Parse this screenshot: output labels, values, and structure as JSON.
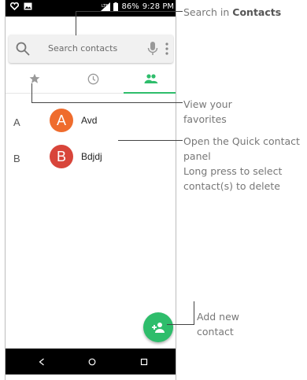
{
  "status_bar": {
    "signal_label": "LTE",
    "battery": "86%",
    "time": "9:28 PM"
  },
  "search": {
    "placeholder": "Search contacts"
  },
  "tabs": [
    {
      "name": "favorites",
      "icon": "star-icon"
    },
    {
      "name": "recents",
      "icon": "clock-icon"
    },
    {
      "name": "contacts",
      "icon": "people-icon",
      "selected": true
    }
  ],
  "contacts": [
    {
      "section": "A",
      "initial": "A",
      "name": "Avd",
      "color": "#ef6c2d"
    },
    {
      "section": "B",
      "initial": "B",
      "name": "Bdjdj",
      "color": "#d8453a"
    }
  ],
  "fab": {
    "icon": "add-person-icon",
    "color": "#2ebd6b"
  },
  "annotations": {
    "search_prefix": "Search in ",
    "search_bold": "Contacts",
    "favorites": "View your\nfavorites",
    "quick_contact": "Open the Quick contact\npanel",
    "long_press": "Long press to select\ncontact(s) to delete",
    "add_contact": "Add new\ncontact"
  },
  "colors": {
    "accent": "#2ebd6b"
  }
}
